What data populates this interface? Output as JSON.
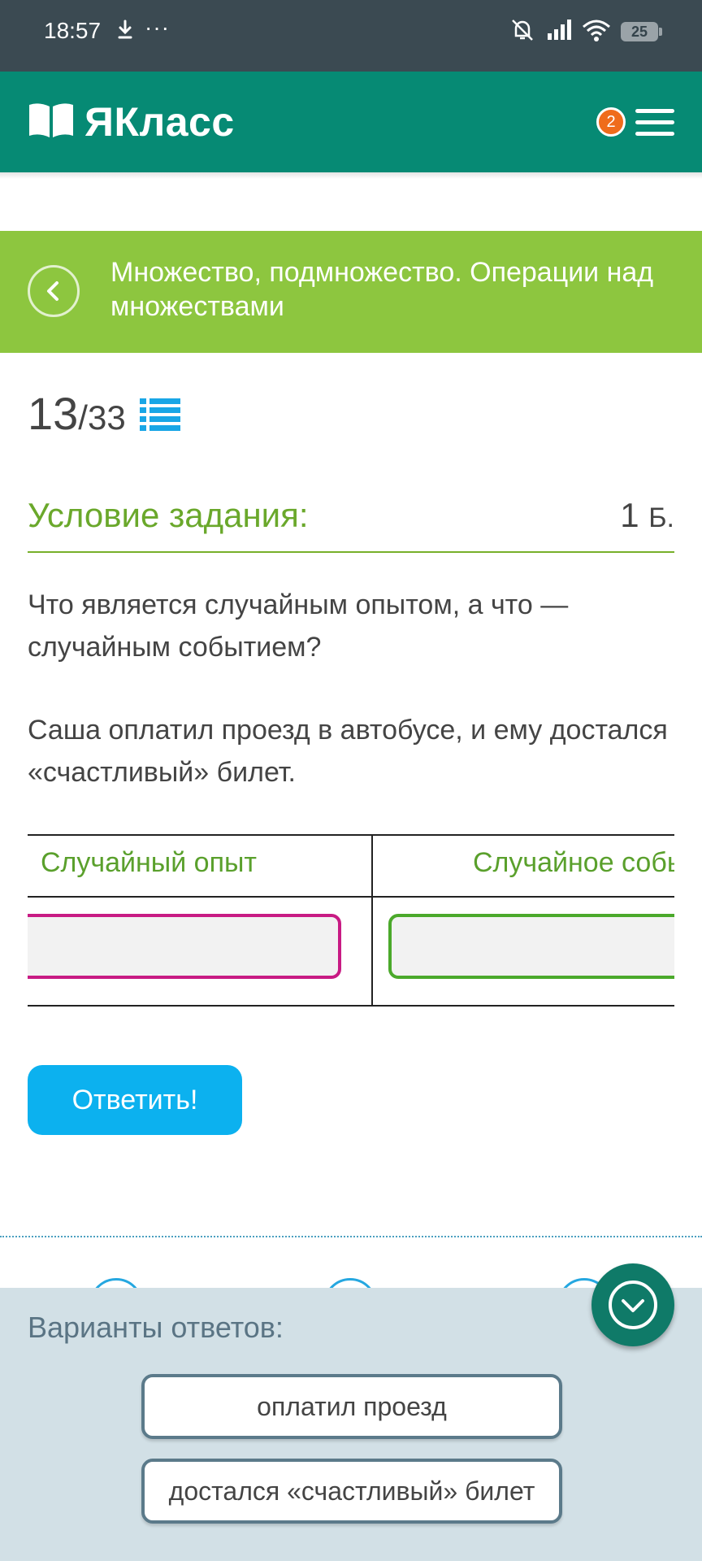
{
  "status_bar": {
    "time": "18:57",
    "more": "···",
    "battery": "25"
  },
  "app": {
    "brand": "ЯКласс",
    "notifications": "2"
  },
  "topic": {
    "title": "Множество, подмножество. Операции над множествами"
  },
  "progress": {
    "current": "13",
    "separator": "/",
    "total": "33"
  },
  "task": {
    "condition_label": "Условие задания:",
    "points_value": "1",
    "points_unit": "Б.",
    "question": "Что является случайным опытом, а что — случайным событием?",
    "scenario": "Саша оплатил проезд в автобусе, и ему достался «счастливый» билет.",
    "table_headers": [
      "Случайный опыт",
      "Случайное собы"
    ],
    "submit_label": "Ответить!"
  },
  "options_panel": {
    "label": "Варианты ответов:",
    "options": [
      "оплатил проезд",
      "достался «счастливый» билет"
    ]
  },
  "colors": {
    "status_bar": "#3b4a52",
    "app_bar": "#068a74",
    "topic_banner": "#8dc63f",
    "accent_green": "#6aa82b",
    "submit": "#0cb1ef",
    "dropzone_1": "#c81b84",
    "dropzone_2": "#4ba92b",
    "badge": "#ef6c1b"
  }
}
